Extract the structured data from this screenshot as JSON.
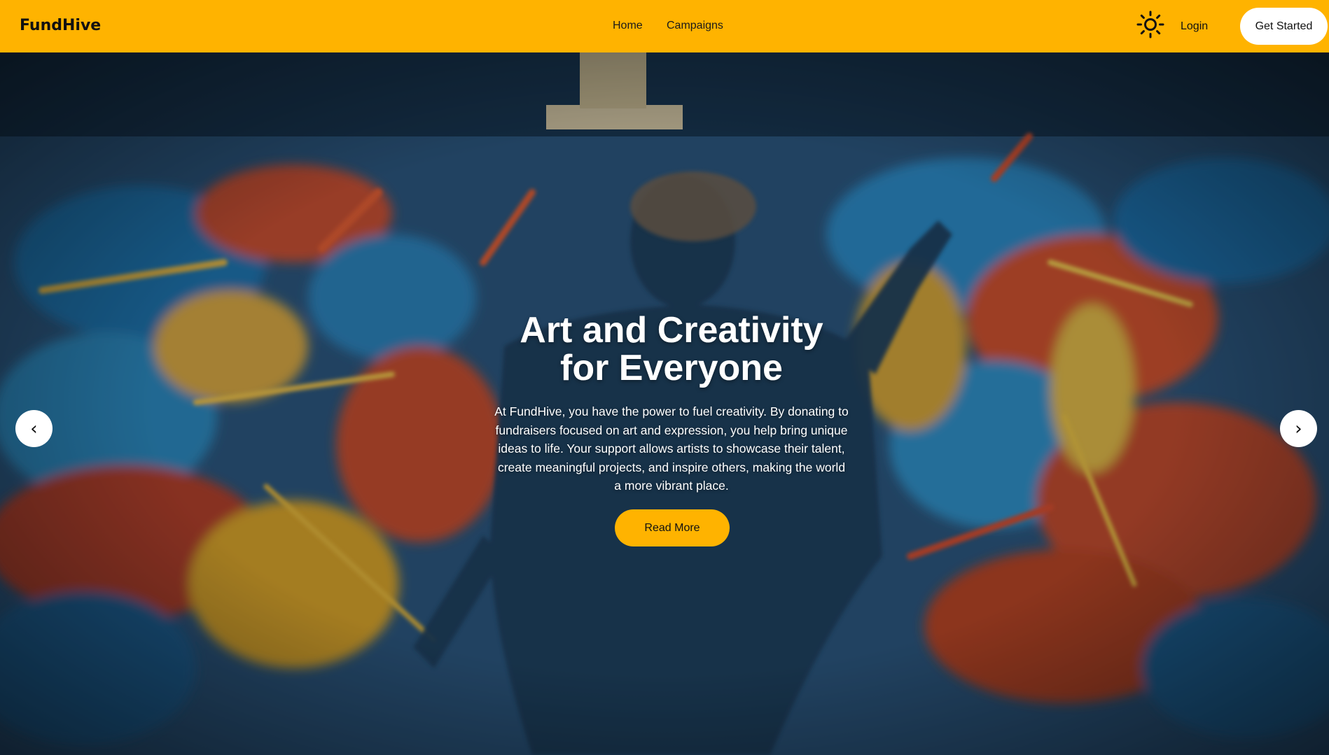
{
  "nav": {
    "brand": "FundHive",
    "links": [
      "Home",
      "Campaigns"
    ],
    "theme_toggle_icon": "sun-icon",
    "login": "Login",
    "cta": "Get Started"
  },
  "hero": {
    "title_line1": "Art and Creativity",
    "title_line2": "for Everyone",
    "text": "At FundHive, you have the power to fuel creativity. By donating to fundraisers focused on art and expression, you help bring unique ideas to life. Your support allows artists to showcase their talent, create meaningful projects, and inspire others, making the world a more vibrant place.",
    "button": "Read More",
    "prev_icon": "‹",
    "next_icon": "›"
  },
  "colors": {
    "accent": "#ffb300",
    "hero_text": "#ffffff"
  }
}
